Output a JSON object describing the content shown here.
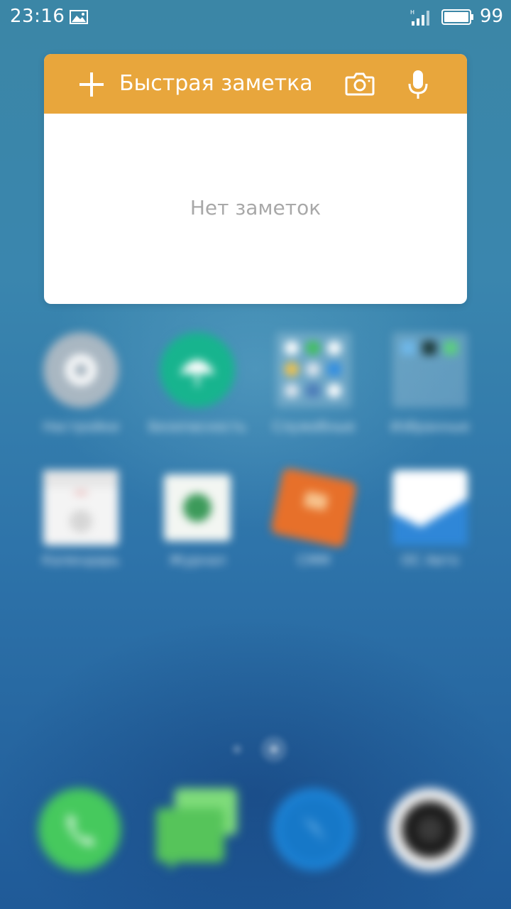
{
  "status_bar": {
    "time": "23:16",
    "battery": "99",
    "icons": [
      "gallery-icon",
      "signal-icon",
      "battery-icon"
    ]
  },
  "note_widget": {
    "title": "Быстрая заметка",
    "empty_text": "Нет заметок",
    "icons": [
      "plus-icon",
      "camera-icon",
      "mic-icon"
    ],
    "colors": {
      "header": "#e8a63c",
      "body": "#ffffff",
      "empty_text": "#a8a8a8"
    }
  },
  "home": {
    "row1": [
      "Настройки",
      "Безопасность",
      "Служебные",
      "Избранные"
    ],
    "row2": [
      "Календарь",
      "Журнал",
      "CMM",
      "ОС Авто"
    ],
    "dock": [
      "phone-icon",
      "messages-icon",
      "browser-icon",
      "camera-app-icon"
    ]
  },
  "colors": {
    "wallpaper_top": "#3b86a6",
    "wallpaper_bottom": "#1f5a98"
  }
}
